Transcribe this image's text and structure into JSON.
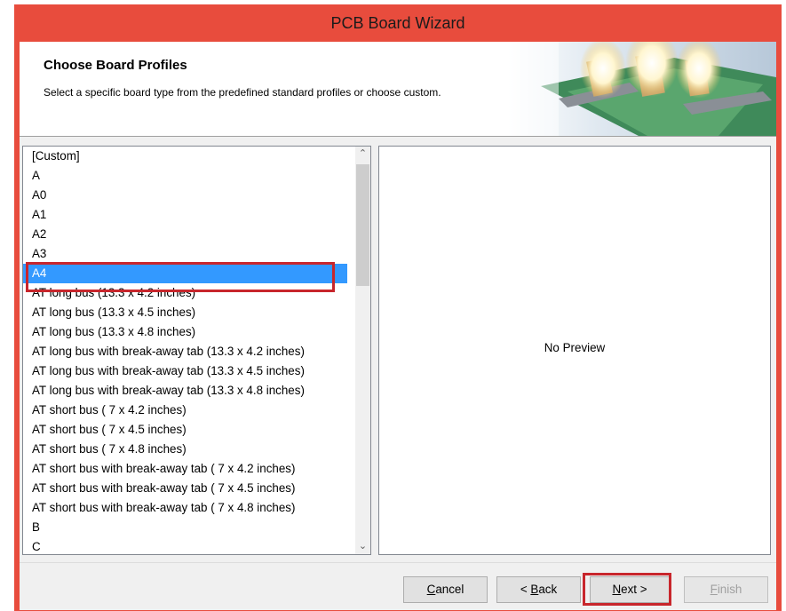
{
  "window": {
    "title": "PCB Board Wizard"
  },
  "header": {
    "title": "Choose Board Profiles",
    "description": "Select a specific board type from the predefined standard profiles or choose custom."
  },
  "board_list": {
    "selected": "A4",
    "items": [
      "[Custom]",
      "A",
      "A0",
      "A1",
      "A2",
      "A3",
      "A4",
      "AT long bus (13.3 x 4.2 inches)",
      "AT long bus (13.3 x 4.5 inches)",
      "AT long bus (13.3 x 4.8 inches)",
      "AT long bus with break-away tab (13.3 x 4.2 inches)",
      "AT long bus with break-away tab (13.3 x 4.5 inches)",
      "AT long bus with break-away tab (13.3 x 4.8 inches)",
      "AT short bus ( 7 x 4.2 inches)",
      "AT short bus ( 7 x 4.5 inches)",
      "AT short bus ( 7 x 4.8 inches)",
      "AT short bus with break-away tab ( 7 x 4.2 inches)",
      "AT short bus with break-away tab ( 7 x 4.5 inches)",
      "AT short bus with break-away tab ( 7 x 4.8 inches)",
      "B",
      "C"
    ]
  },
  "preview": {
    "text": "No Preview"
  },
  "buttons": {
    "cancel": {
      "accel": "C",
      "rest": "ancel"
    },
    "back": {
      "prefix": "< ",
      "accel": "B",
      "rest": "ack"
    },
    "next": {
      "accel": "N",
      "rest": "ext >"
    },
    "finish": {
      "accel": "F",
      "rest": "inish"
    }
  },
  "colors": {
    "accent": "#e84c3d",
    "selection": "#3399ff",
    "highlight_box": "#c8262c"
  },
  "icons": {
    "scroll_up": "chevron-up-icon",
    "scroll_down": "chevron-down-icon"
  }
}
